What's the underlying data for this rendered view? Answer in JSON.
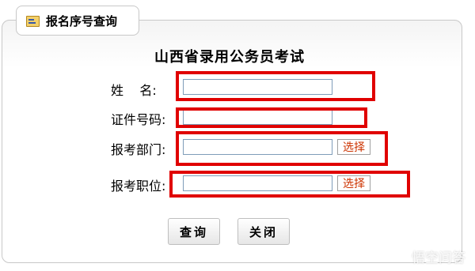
{
  "tab": {
    "title": "报名序号查询",
    "icon": "id-card-icon"
  },
  "form": {
    "title": "山西省录用公务员考试",
    "rows": [
      {
        "label": "姓    名:",
        "value": ""
      },
      {
        "label": "证件号码:",
        "value": ""
      },
      {
        "label": "报考部门:",
        "value": "",
        "select_label": "选择"
      },
      {
        "label": "报考职位:",
        "value": "",
        "select_label": "选择"
      }
    ]
  },
  "buttons": {
    "query": "查询",
    "close": "关闭"
  },
  "highlight_color": "#e00000",
  "watermark": {
    "text": "悟空问答",
    "icon": "speech-bubble-icon"
  }
}
